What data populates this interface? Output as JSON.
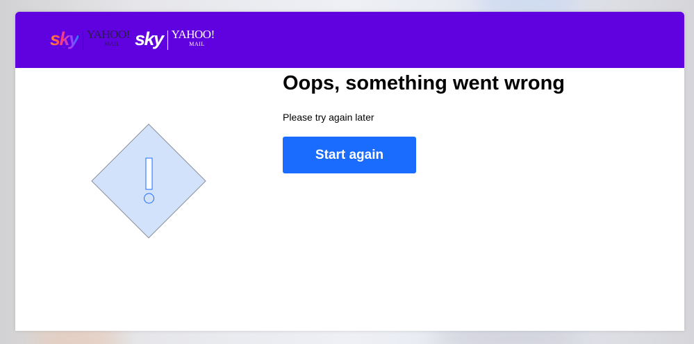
{
  "brand": {
    "logo_left": {
      "sky": "sky",
      "yahoo": "YAHOO!",
      "mail": "MAIL"
    },
    "logo_right": {
      "sky": "sky",
      "yahoo": "YAHOO!",
      "mail": "MAIL"
    },
    "header_color": "#6001e0"
  },
  "error": {
    "icon": "warning-diamond-icon",
    "title": "Oops, something went wrong",
    "message": "Please try again later",
    "button_label": "Start again",
    "button_color": "#1a6cff"
  }
}
